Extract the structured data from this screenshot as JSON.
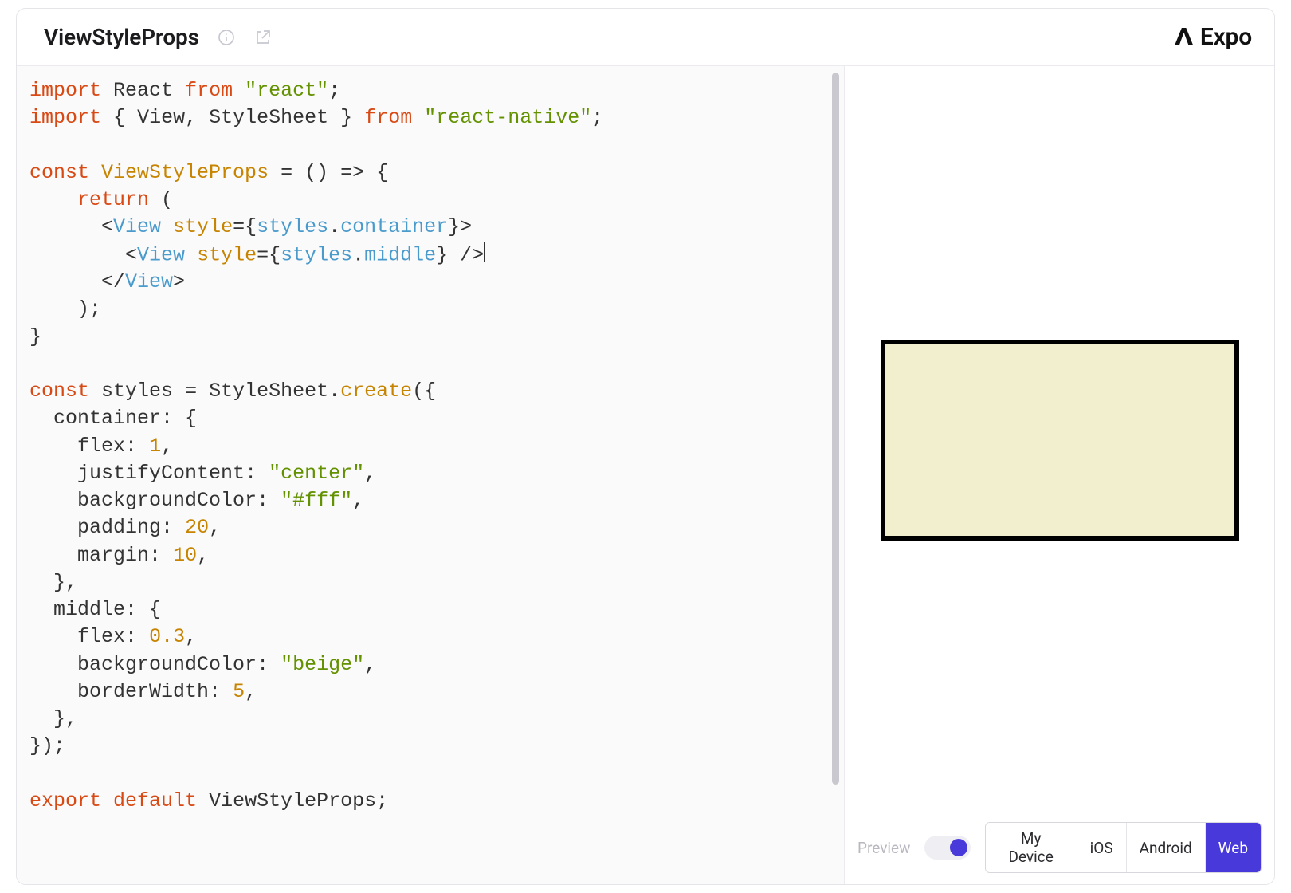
{
  "header": {
    "title": "ViewStyleProps",
    "brand": "Expo",
    "icons": {
      "info": "info-icon",
      "open": "open-external-icon",
      "brand": "chevron-up-icon"
    }
  },
  "editor": {
    "code_plain": "import React from \"react\";\nimport { View, StyleSheet } from \"react-native\";\n\nconst ViewStyleProps = () => {\n    return (\n      <View style={styles.container}>\n        <View style={styles.middle} />\n      </View>\n    );\n}\n\nconst styles = StyleSheet.create({\n  container: {\n    flex: 1,\n    justifyContent: \"center\",\n    backgroundColor: \"#fff\",\n    padding: 20,\n    margin: 10,\n  },\n  middle: {\n    flex: 0.3,\n    backgroundColor: \"beige\",\n    borderWidth: 5,\n  },\n});\n\nexport default ViewStyleProps;",
    "cursor_line": 7
  },
  "preview": {
    "render": {
      "bg": "#f1efce",
      "borderColor": "#000",
      "borderWidth": 6
    }
  },
  "footer": {
    "preview_label": "Preview",
    "toggle_on": true,
    "platforms": [
      "My Device",
      "iOS",
      "Android",
      "Web"
    ],
    "platform_selected": "Web"
  }
}
